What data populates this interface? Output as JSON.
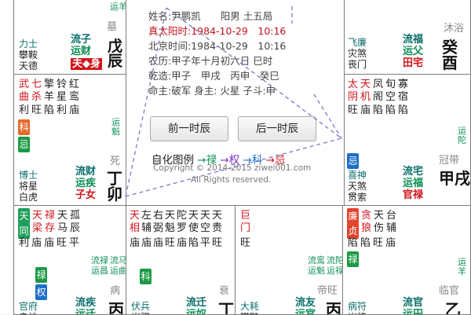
{
  "center": {
    "lines": [
      {
        "label": "姓名:",
        "value": "尹鹏凯　　阳男 土五局",
        "color": "#444444"
      },
      {
        "label": "真太阳时:",
        "value": "1984-10-29　10:16",
        "color": "#c0141a"
      },
      {
        "label": "北京时间:",
        "value": "1984-10-29　10:16",
        "color": "#444444"
      },
      {
        "label": "农历:",
        "value": "甲子年十月初六日 巳时",
        "color": "#444444"
      },
      {
        "label": "乾造:",
        "value": "甲子　甲戌　丙申　癸巳",
        "color": "#444444"
      },
      {
        "label": "命主:",
        "value": "破军 身主: 火星 子斗:申",
        "color": "#444444"
      }
    ],
    "prev_label": "前一时辰",
    "next_label": "后一时辰",
    "legend_label": "自化图例",
    "legend_items": [
      "禄",
      "权",
      "科",
      "忌"
    ],
    "legend_arrow": "→",
    "copyright": "Copyright © 2014-2015 ziwei001.com",
    "rights": "All Rights reserved."
  },
  "palaces": {
    "top_left": {
      "top_text": "运羊",
      "minor": [
        "力士",
        "攀鞍",
        "天德"
      ],
      "pal1": "流子",
      "pal2": "运财",
      "pal3": "夫◆身",
      "state": "墓",
      "gz": "戊辰"
    },
    "top_right": {
      "top_text": "沐浴",
      "minor": [
        "飞廉",
        "灾煞",
        "丧门"
      ],
      "pal1": "流福",
      "pal2": "运父",
      "pal3": "田宅",
      "gz": "癸酉"
    },
    "left_mid": {
      "stars": [
        "武",
        "七",
        "擎",
        "铃",
        "红"
      ],
      "stars2": [
        "曲",
        "杀",
        "羊",
        "星",
        "鸾"
      ],
      "bright": [
        "利",
        "旺",
        "陷",
        "利",
        "庙"
      ],
      "ke": "科",
      "ji": "忌",
      "yun": "运魁",
      "minor": [
        "博士",
        "将星",
        "白虎"
      ],
      "pal1": "流财",
      "pal2": "运疾",
      "pal3": "子女",
      "state": "死",
      "gz": "丁卯"
    },
    "right_mid": {
      "stars": [
        "太",
        "天",
        "凤",
        "旬",
        "寡"
      ],
      "stars2": [
        "阴",
        "机",
        "阁",
        "空",
        "宿"
      ],
      "bright": [
        "旺",
        "庙",
        "陷",
        "陷",
        "陷"
      ],
      "ji": "忌",
      "yun": "运陀",
      "minor": [
        "喜神",
        "天煞",
        "贯索"
      ],
      "pal1": "流宅",
      "pal2": "运福",
      "pal3": "官禄",
      "state": "冠带",
      "gz": "甲戌"
    },
    "bottom1": {
      "badge1": "天",
      "badge2": "同",
      "stars": [
        "天",
        "禄",
        "天",
        "孤"
      ],
      "stars2": [
        "梁",
        "存",
        "马",
        "辰"
      ],
      "bright": [
        "利",
        "庙",
        "庙",
        "旺",
        "平"
      ],
      "lu": "禄",
      "quan": "权",
      "yun": [
        "流禄",
        "运昌"
      ],
      "yun2": [
        "流马",
        "运曲"
      ],
      "minor": [
        "官府",
        "息神"
      ],
      "pal1": "流疾",
      "pal2": "运迁",
      "state": "病",
      "gz": "丙"
    },
    "bottom2": {
      "stars": [
        "天",
        "左",
        "右",
        "天",
        "陀",
        "天",
        "天",
        "天"
      ],
      "stars2": [
        "相",
        "辅",
        "弼",
        "魁",
        "罗",
        "使",
        "空",
        "贵"
      ],
      "bright": [
        "庙",
        "庙",
        "庙",
        "旺",
        "庙",
        "陷",
        "平",
        "旺"
      ],
      "ke": "科",
      "minor": [
        "伏兵",
        "岁驿"
      ],
      "pal1": "流迁",
      "pal2": "运奴",
      "state": "衰",
      "gz": "丁"
    },
    "bottom3": {
      "stars": [
        "巨"
      ],
      "stars2": [
        "门"
      ],
      "bright": [
        "旺"
      ],
      "yun": [
        "流鸾",
        "运魁"
      ],
      "yun2": [
        "流陀",
        "运禄"
      ],
      "minor": [
        "大耗",
        "攀鞍"
      ],
      "pal1": "流友",
      "pal2": "运官",
      "state": "帝旺",
      "gz": "丙"
    },
    "bottom4": {
      "badge1": "廉",
      "badge2": "贞",
      "stars": [
        "贪",
        "天",
        "台"
      ],
      "stars2": [
        "狼",
        "伤",
        "辅"
      ],
      "bright": [
        "陷",
        "陷",
        "旺",
        "庙"
      ],
      "lu": "禄",
      "yun": "运羊",
      "minor": [
        "病符",
        "岁建"
      ],
      "pal1": "流官",
      "pal2": "运田",
      "state": "临官",
      "gz": "乙"
    }
  }
}
